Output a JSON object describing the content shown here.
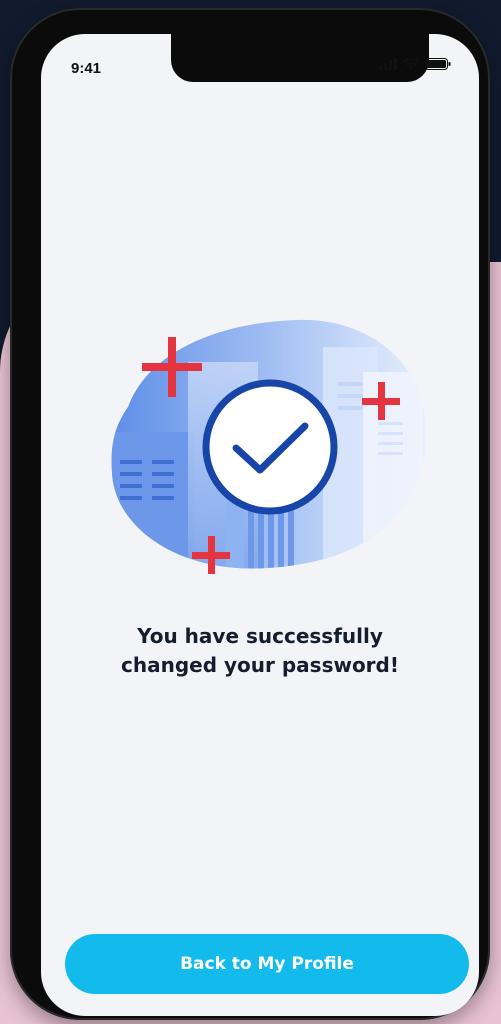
{
  "status_bar": {
    "time": "9:41",
    "icons": [
      "signal-icon",
      "wifi-icon",
      "battery-icon"
    ]
  },
  "illustration": {
    "icons": [
      "success-check-icon",
      "cross-icon",
      "city-buildings-icon"
    ],
    "colors": {
      "accent_red": "#e4343f",
      "check_blue": "#1845a8",
      "building_blue": "#8eb3f2"
    }
  },
  "message": {
    "line1": "You have successfully",
    "line2": "changed your password!"
  },
  "cta": {
    "label": "Back to My Profile",
    "color": "#12bbec"
  }
}
